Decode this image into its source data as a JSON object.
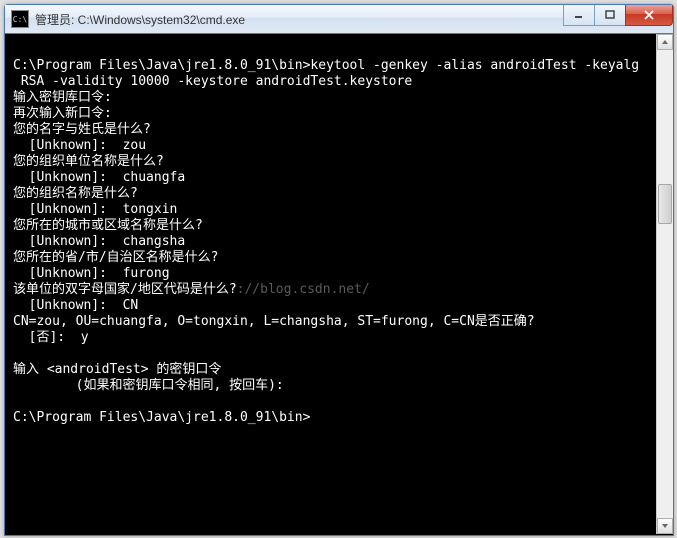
{
  "window": {
    "icon_label": "C:\\",
    "title": "管理员: C:\\Windows\\system32\\cmd.exe"
  },
  "terminal": {
    "lines": [
      "",
      "C:\\Program Files\\Java\\jre1.8.0_91\\bin>keytool -genkey -alias androidTest -keyalg",
      " RSA -validity 10000 -keystore androidTest.keystore",
      "输入密钥库口令:",
      "再次输入新口令:",
      "您的名字与姓氏是什么?",
      "  [Unknown]:  zou",
      "您的组织单位名称是什么?",
      "  [Unknown]:  chuangfa",
      "您的组织名称是什么?",
      "  [Unknown]:  tongxin",
      "您所在的城市或区域名称是什么?",
      "  [Unknown]:  changsha",
      "您所在的省/市/自治区名称是什么?",
      "  [Unknown]:  furong",
      "该单位的双字母国家/地区代码是什么?",
      "  [Unknown]:  CN",
      "CN=zou, OU=chuangfa, O=tongxin, L=changsha, ST=furong, C=CN是否正确?",
      "  [否]:  y",
      "",
      "输入 <androidTest> 的密钥口令",
      "        (如果和密钥库口令相同, 按回车):",
      "",
      "C:\\Program Files\\Java\\jre1.8.0_91\\bin>"
    ],
    "watermark": {
      "text": "://blog.csdn.net/",
      "line_index": 15
    }
  }
}
